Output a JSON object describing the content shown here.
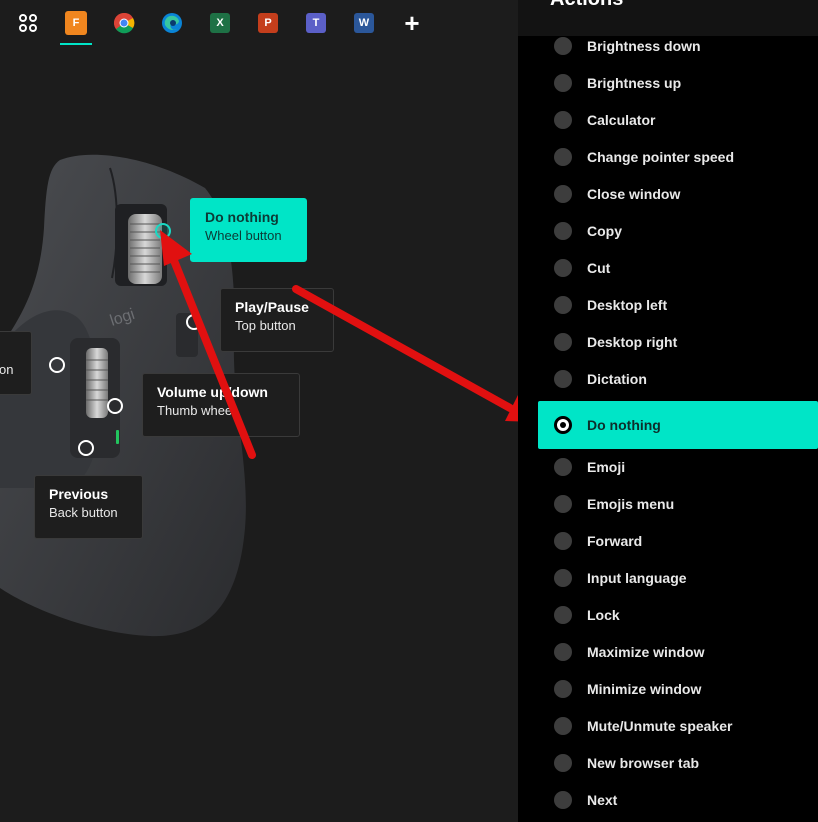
{
  "taskbar": {
    "apps": [
      {
        "name": "launcher",
        "icon": "grid-icon"
      },
      {
        "name": "fusion",
        "icon": "fusion-icon",
        "letter": "F",
        "color": "#f0861f"
      },
      {
        "name": "chrome",
        "icon": "chrome-icon"
      },
      {
        "name": "edge",
        "icon": "edge-icon"
      },
      {
        "name": "excel",
        "icon": "excel-icon",
        "letter": "X",
        "color": "#1e7145"
      },
      {
        "name": "powerpoint",
        "icon": "powerpoint-icon",
        "letter": "P",
        "color": "#c43e1c"
      },
      {
        "name": "teams",
        "icon": "teams-icon",
        "letter": "T",
        "color": "#5b5fc7"
      },
      {
        "name": "word",
        "icon": "word-icon",
        "letter": "W",
        "color": "#2b579a"
      }
    ],
    "add_label": "+"
  },
  "mouse": {
    "logo": "logi",
    "callouts": {
      "wheel": {
        "title": "Do nothing",
        "subtitle": "Wheel button"
      },
      "top": {
        "title": "Play/Pause",
        "subtitle": "Top button"
      },
      "thumb": {
        "title": "Volume up/down",
        "subtitle": "Thumb wheel"
      },
      "back": {
        "title": "Previous",
        "subtitle": "Back button"
      },
      "gesture_fragment": "on"
    }
  },
  "actions_panel": {
    "title": "Actions",
    "items": [
      "Brightness down",
      "Brightness up",
      "Calculator",
      "Change pointer speed",
      "Close window",
      "Copy",
      "Cut",
      "Desktop left",
      "Desktop right",
      "Dictation",
      "Do nothing",
      "Emoji",
      "Emojis menu",
      "Forward",
      "Input language",
      "Lock",
      "Maximize window",
      "Minimize window",
      "Mute/Unmute speaker",
      "New browser tab",
      "Next"
    ],
    "selected": "Do nothing"
  },
  "colors": {
    "accent": "#00e5c7",
    "arrow": "#e11010",
    "panel_bg": "#000000"
  }
}
